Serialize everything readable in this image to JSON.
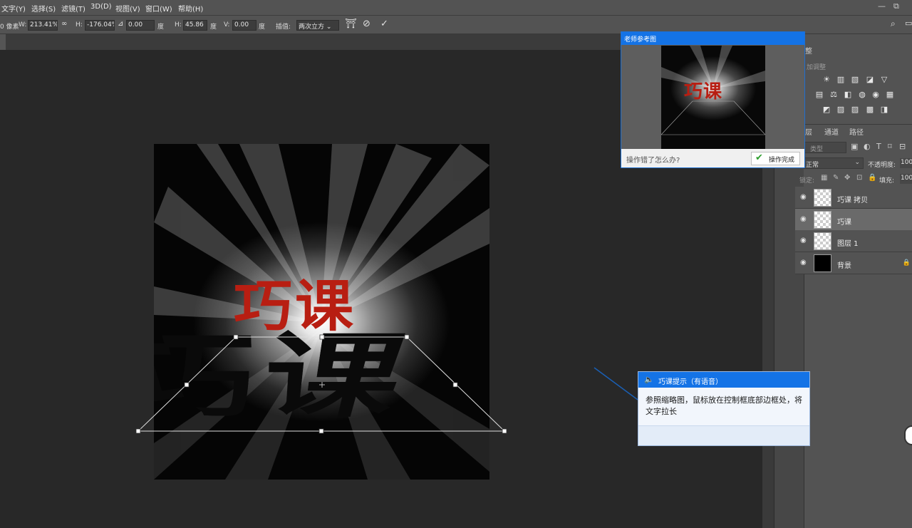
{
  "menubar": {
    "items": [
      "文字(Y)",
      "选择(S)",
      "滤镜(T)",
      "3D(D)",
      "视图(V)",
      "窗口(W)",
      "帮助(H)"
    ],
    "window_controls": [
      "—",
      "⧉"
    ]
  },
  "options": {
    "x_unit": "0 像素",
    "w_label": "W:",
    "w_value": "213.41%",
    "h_label": "H:",
    "h_value": "-176.04%",
    "angle_value": "0.00",
    "deg1": "度",
    "hskew_label": "H:",
    "hskew_value": "45.86",
    "deg2": "度",
    "vskew_label": "V:",
    "vskew_value": "0.00",
    "deg3": "度",
    "interp_label": "插值:",
    "interp_value": "两次立方",
    "icons": [
      "warp-icon",
      "cancel-icon",
      "commit-icon",
      "search-icon",
      "workspace-icon"
    ]
  },
  "canvas": {
    "title_text": "巧课",
    "shadow_text": "巧课"
  },
  "reference_window": {
    "title": "老师参考图",
    "ref_title": "巧课",
    "question": "操作错了怎么办?",
    "done_button": "操作完成"
  },
  "hint_window": {
    "title": "巧课提示（有语音）",
    "body": "参照缩略图，鼠标放在控制框底部边框处，将文字拉长"
  },
  "adjustments": {
    "tab": "整",
    "subtitle": "加调整"
  },
  "layers_panel": {
    "tabs": [
      "层",
      "通道",
      "路径"
    ],
    "filter_placeholder": "类型",
    "blend_mode": "正常",
    "opacity_label": "不透明度:",
    "opacity_value": "100",
    "lock_label": "锁定:",
    "fill_label": "填充:",
    "fill_value": "100",
    "layers": [
      {
        "name": "巧课 拷贝",
        "selected": false,
        "thumb": "text"
      },
      {
        "name": "巧课",
        "selected": true,
        "thumb": "text"
      },
      {
        "name": "图层 1",
        "selected": false,
        "thumb": "transparent"
      },
      {
        "name": "背景",
        "selected": false,
        "thumb": "black"
      }
    ]
  },
  "colors": {
    "accent": "#1473e6",
    "title_red": "#b81e12",
    "ui_bg": "#535353",
    "canvas_bg": "#282828"
  }
}
